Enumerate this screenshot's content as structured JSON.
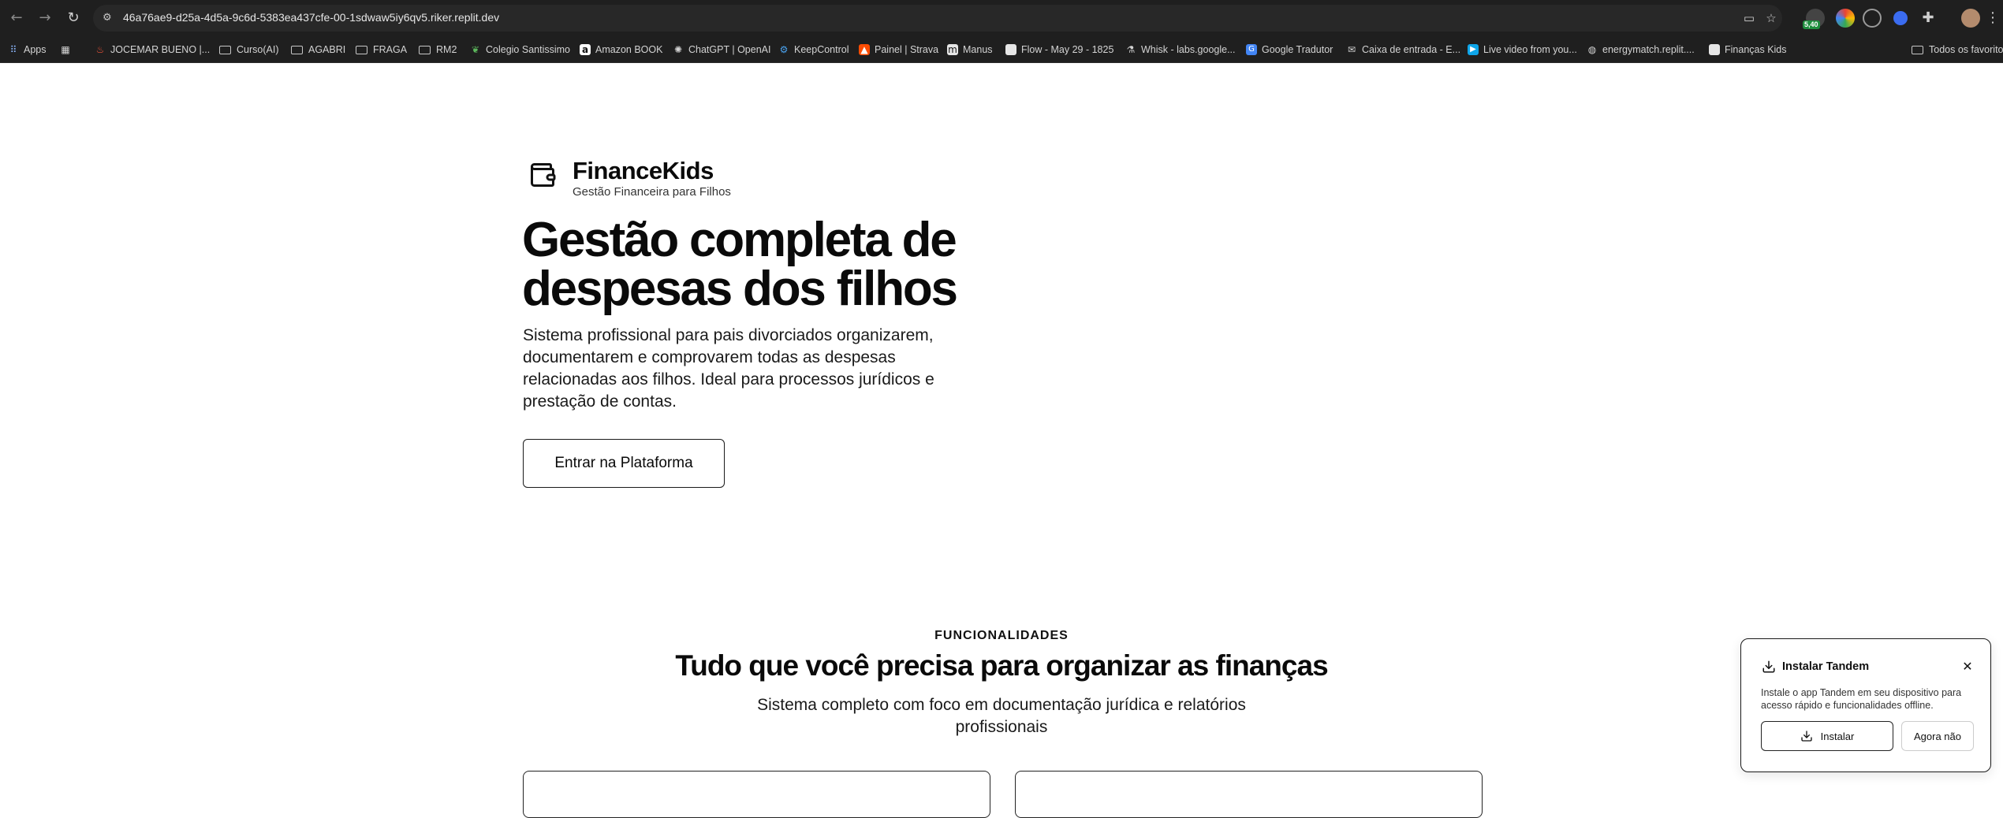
{
  "browser": {
    "url": "46a76ae9-d25a-4d5a-9c6d-5383ea437cfe-00-1sdwaw5iy6qv5.riker.replit.dev",
    "extension_badge": "5,40",
    "bookmarks": [
      {
        "label": "Apps",
        "icon": "apps-grid-icon"
      },
      {
        "label": "",
        "icon": "grid-icon"
      },
      {
        "label": "JOCEMAR BUENO |...",
        "icon": "flame-icon"
      },
      {
        "label": "Curso(AI)",
        "icon": "folder-icon"
      },
      {
        "label": "AGABRI",
        "icon": "folder-icon"
      },
      {
        "label": "FRAGA",
        "icon": "folder-icon"
      },
      {
        "label": "RM2",
        "icon": "folder-icon"
      },
      {
        "label": "Colegio Santissimo",
        "icon": "leaf-icon"
      },
      {
        "label": "Amazon BOOK",
        "icon": "amazon-icon"
      },
      {
        "label": "ChatGPT | OpenAI",
        "icon": "openai-icon"
      },
      {
        "label": "KeepControl",
        "icon": "gear-icon"
      },
      {
        "label": "Painel | Strava",
        "icon": "strava-icon"
      },
      {
        "label": "Manus",
        "icon": "manus-icon"
      },
      {
        "label": "Flow - May 29 - 1825",
        "icon": "doc-icon"
      },
      {
        "label": "Whisk - labs.google...",
        "icon": "flask-icon"
      },
      {
        "label": "Google Tradutor",
        "icon": "translate-icon"
      },
      {
        "label": "Caixa de entrada - E...",
        "icon": "mail-icon"
      },
      {
        "label": "Live video from you...",
        "icon": "video-icon"
      },
      {
        "label": "energymatch.replit....",
        "icon": "globe-icon"
      },
      {
        "label": "Finanças Kids",
        "icon": "page-icon"
      }
    ],
    "all_bookmarks": "Todos os favoritos"
  },
  "brand": {
    "name": "FinanceKids",
    "tagline": "Gestão Financeira para Filhos"
  },
  "hero": {
    "title_line1": "Gestão completa de",
    "title_line2": "despesas dos filhos",
    "description": "Sistema profissional para pais divorciados organizarem, documentarem e comprovarem todas as despesas relacionadas aos filhos. Ideal para processos jurídicos e prestação de contas.",
    "cta_label": "Entrar na Plataforma"
  },
  "features": {
    "kicker": "FUNCIONALIDADES",
    "title": "Tudo que você precisa para organizar as finanças",
    "description": "Sistema completo com foco em documentação jurídica e relatórios profissionais"
  },
  "install_popup": {
    "title": "Instalar Tandem",
    "text": "Instale o app Tandem em seu dispositivo para acesso rápido e funcionalidades offline.",
    "install_label": "Instalar",
    "later_label": "Agora não"
  },
  "colors": {
    "chrome_bg": "#1f1f1f",
    "omnibox_bg": "#282828",
    "page_bg": "#ffffff",
    "text": "#0a0a0a"
  }
}
